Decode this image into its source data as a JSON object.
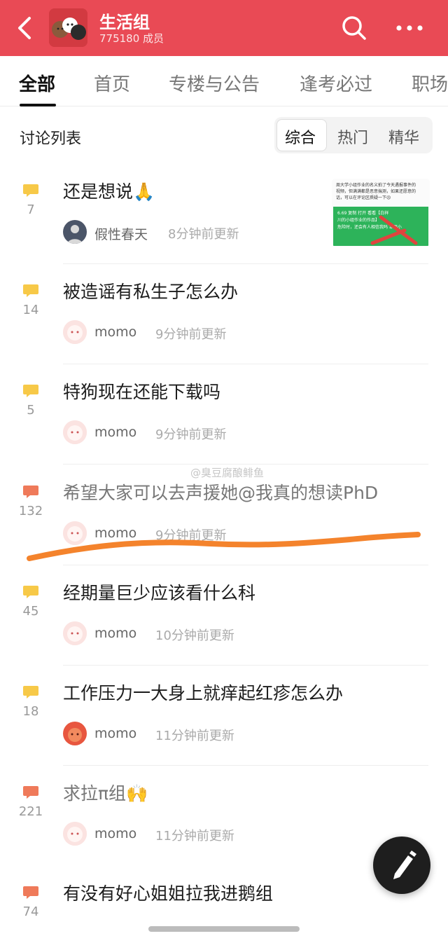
{
  "header": {
    "title": "生活组",
    "members": "775180 成员"
  },
  "tabs": [
    "全部",
    "首页",
    "专楼与公告",
    "逢考必过",
    "职场"
  ],
  "list_header": {
    "title": "讨论列表",
    "filters": [
      "综合",
      "热门",
      "精华"
    ]
  },
  "thumbnail": {
    "line1": "周大学小组作业的名义拍了今天遇报事件的",
    "line2": "视频，但满满都是恶意揣测，如果还愿意的",
    "line3": "话，可以在评论区质疑一下😣",
    "green1": "6.69 复制 打开 看看【白祥",
    "green2": "川的小组作业的作品】",
    "green3": "危险时，还会有人相信我吗 本周小"
  },
  "posts": [
    {
      "count": "7",
      "title": "还是想说🙏",
      "user": "假性春天",
      "time": "8分钟前更新"
    },
    {
      "count": "14",
      "title": "被造谣有私生子怎么办",
      "user": "momo",
      "time": "9分钟前更新"
    },
    {
      "count": "5",
      "title": "特狗现在还能下载吗",
      "user": "momo",
      "time": "9分钟前更新"
    },
    {
      "count": "132",
      "title": "希望大家可以去声援她@我真的想读PhD",
      "user": "momo",
      "time": "9分钟前更新"
    },
    {
      "count": "45",
      "title": "经期量巨少应该看什么科",
      "user": "momo",
      "time": "10分钟前更新"
    },
    {
      "count": "18",
      "title": "工作压力一大身上就痒起红疹怎么办",
      "user": "momo",
      "time": "11分钟前更新"
    },
    {
      "count": "221",
      "title": "求拉π组🙌",
      "user": "momo",
      "time": "11分钟前更新"
    },
    {
      "count": "74",
      "title": "有没有好心姐姐拉我进鹅组",
      "user": "",
      "time": ""
    }
  ],
  "watermark": "@臭豆腐酿鲱鱼",
  "colors": {
    "header": "#e94a55",
    "bubble_yellow": "#f7c948",
    "bubble_hot": "#ef7a5a",
    "scribble": "#f4832c"
  }
}
